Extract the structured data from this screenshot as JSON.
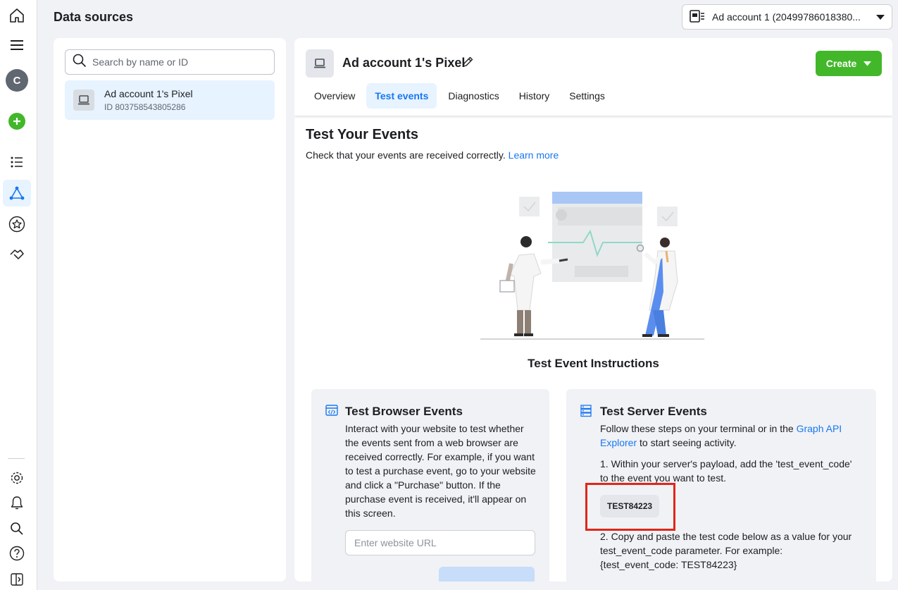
{
  "header": {
    "title": "Data sources",
    "account_selector": "Ad account 1 (20499786018380..."
  },
  "rail": {
    "avatar_letter": "C"
  },
  "left_panel": {
    "search_placeholder": "Search by name or ID",
    "items": [
      {
        "name": "Ad account 1's Pixel",
        "id_label": "ID 803758543805286"
      }
    ]
  },
  "pixel": {
    "title": "Ad account 1's Pixel",
    "create_label": "Create",
    "tabs": [
      "Overview",
      "Test events",
      "Diagnostics",
      "History",
      "Settings"
    ],
    "active_tab": "Test events"
  },
  "test_events": {
    "title": "Test Your Events",
    "description": "Check that your events are received correctly.",
    "learn_more": "Learn more",
    "instructions_title": "Test Event Instructions",
    "browser": {
      "title": "Test Browser Events",
      "body": "Interact with your website to test whether the events sent from a web browser are received correctly. For example, if you want to test a purchase event, go to your website and click a \"Purchase\" button. If the purchase event is received, it'll appear on this screen.",
      "url_placeholder": "Enter website URL"
    },
    "server": {
      "title": "Test Server Events",
      "intro_before": "Follow these steps on your terminal or in the ",
      "intro_link": "Graph API Explorer",
      "intro_after": " to start seeing activity.",
      "step1": "1. Within your server's payload, add the 'test_event_code' to the event you want to test.",
      "test_code": "TEST84223",
      "step2": "2. Copy and paste the test code below as a value for your test_event_code parameter. For example: {test_event_code: TEST84223}"
    }
  },
  "colors": {
    "primary": "#1877f2",
    "create_green": "#42b72a",
    "selected_bg": "#e7f3ff",
    "highlight_red": "#e0261a"
  }
}
